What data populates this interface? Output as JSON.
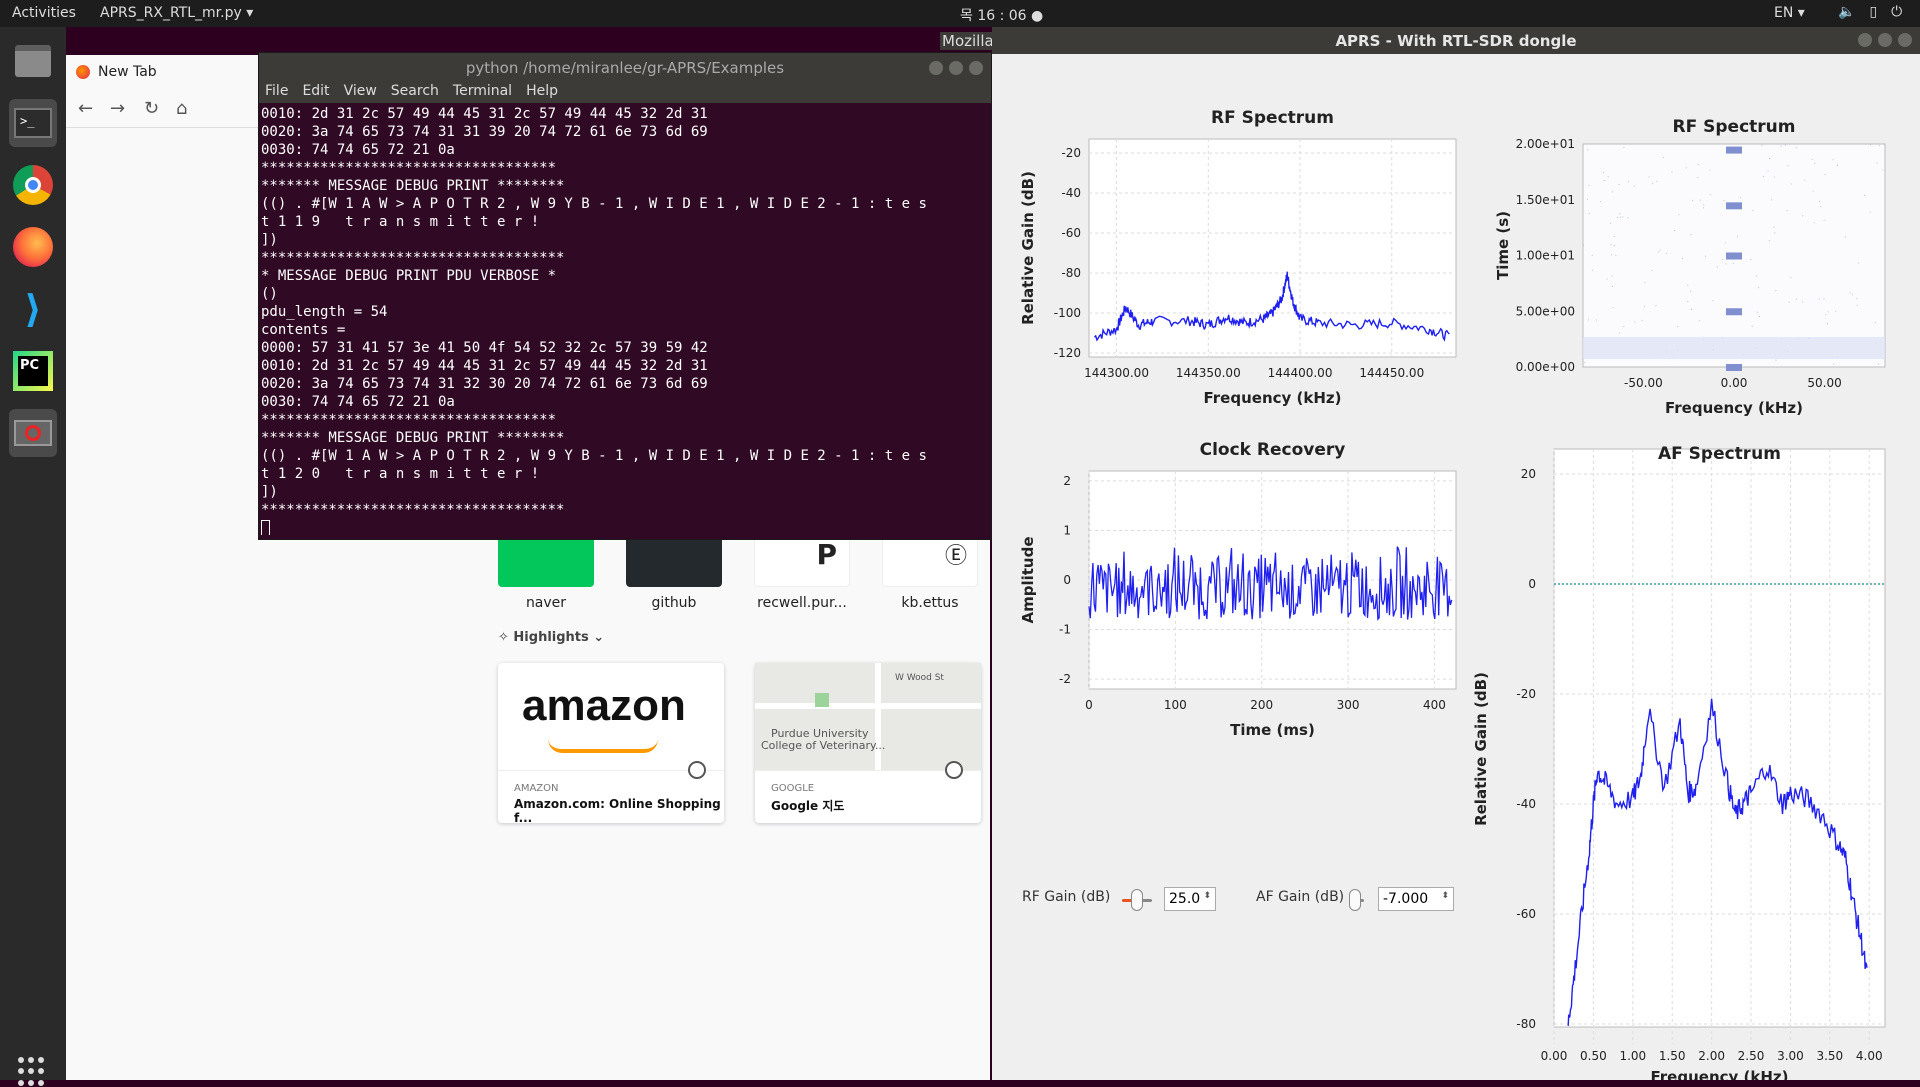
{
  "topbar": {
    "activities": "Activities",
    "app_name": "APRS_RX_RTL_mr.py ▾",
    "clock": "목 16 : 06 ●",
    "lang": "EN ▾"
  },
  "firefox": {
    "tab_title": "New Tab",
    "mozilla_label": "Mozilla",
    "tiles": [
      {
        "label": "naver"
      },
      {
        "label": "github"
      },
      {
        "label": "recwell.pur..."
      },
      {
        "label": "kb.ettus"
      }
    ],
    "highlights_label": "Highlights",
    "cards": [
      {
        "source": "AMAZON",
        "title": "Amazon.com: Online Shopping f...",
        "logo": "amazon"
      },
      {
        "source": "GOOGLE",
        "title": "Google 지도",
        "map_text_1": "Purdue University",
        "map_text_2": "College of Veterinary...",
        "map_street": "W Wood St"
      }
    ]
  },
  "terminal": {
    "title": "python  /home/miranlee/gr-APRS/Examples",
    "menu": [
      "File",
      "Edit",
      "View",
      "Search",
      "Terminal",
      "Help"
    ],
    "lines": [
      "0010: 2d 31 2c 57 49 44 45 31 2c 57 49 44 45 32 2d 31",
      "0020: 3a 74 65 73 74 31 31 39 20 74 72 61 6e 73 6d 69",
      "0030: 74 74 65 72 21 0a",
      "***********************************",
      "******* MESSAGE DEBUG PRINT ********",
      "(() . #[W 1 A W > A P O T R 2 , W 9 Y B - 1 , W I D E 1 , W I D E 2 - 1 : t e s",
      "t 1 1 9   t r a n s m i t t e r !",
      "])",
      "************************************",
      "* MESSAGE DEBUG PRINT PDU VERBOSE *",
      "()",
      "pdu_length = 54",
      "contents =",
      "0000: 57 31 41 57 3e 41 50 4f 54 52 32 2c 57 39 59 42",
      "0010: 2d 31 2c 57 49 44 45 31 2c 57 49 44 45 32 2d 31",
      "0020: 3a 74 65 73 74 31 32 30 20 74 72 61 6e 73 6d 69",
      "0030: 74 74 65 72 21 0a",
      "***********************************",
      "******* MESSAGE DEBUG PRINT ********",
      "(() . #[W 1 A W > A P O T R 2 , W 9 Y B - 1 , W I D E 1 , W I D E 2 - 1 : t e s",
      "t 1 2 0   t r a n s m i t t e r !",
      "])",
      "************************************"
    ]
  },
  "aprs": {
    "window_title": "APRS - With RTL-SDR dongle",
    "rf_gain_label": "RF Gain (dB)",
    "rf_gain_value": "25.0",
    "rf_gain_level": 0.5,
    "af_gain_label": "AF Gain (dB)",
    "af_gain_value": "-7.000",
    "af_gain_level": 0.05
  },
  "chart_data": [
    {
      "type": "line",
      "title": "RF Spectrum",
      "xlabel": "Frequency (kHz)",
      "ylabel": "Relative Gain (dB)",
      "xlim": [
        144285,
        144485
      ],
      "ylim": [
        -123,
        -105
      ],
      "xticks": [
        "144300.00",
        "144350.00",
        "144400.00",
        "144450.00"
      ],
      "yticks": [
        "-20",
        "-40",
        "-60",
        "-80",
        "-100",
        "-120"
      ],
      "yrange": [
        -122,
        -13
      ],
      "series": [
        {
          "color": "#1f1ff0",
          "x": [
            144288,
            144300,
            144305,
            144312,
            144320,
            144340,
            144350,
            144360,
            144370,
            144380,
            144385,
            144390,
            144393,
            144396,
            144400,
            144410,
            144430,
            144450,
            144470,
            144482
          ],
          "y": [
            -112,
            -108,
            -97,
            -106,
            -104,
            -104,
            -106,
            -102,
            -105,
            -103,
            -100,
            -93,
            -81,
            -94,
            -103,
            -105,
            -106,
            -105,
            -108,
            -112
          ]
        }
      ]
    },
    {
      "type": "heatmap",
      "title": "RF Spectrum",
      "xlabel": "Frequency (kHz)",
      "ylabel": "Time (s)",
      "xticks": [
        "-50.00",
        "0.00",
        "50.00"
      ],
      "yticks": [
        "2.00e+01",
        "1.50e+01",
        "1.00e+01",
        "5.00e+00",
        "0.00e+00"
      ],
      "bursts_time": [
        0,
        5,
        10,
        14.5,
        19.5
      ]
    },
    {
      "type": "line",
      "title": "Clock Recovery",
      "xlabel": "Time (ms)",
      "ylabel": "Amplitude",
      "xlim": [
        0,
        425
      ],
      "ylim": [
        -2.2,
        2.2
      ],
      "xticks": [
        "0",
        "100",
        "200",
        "300",
        "400"
      ],
      "yticks": [
        "2",
        "1",
        "0",
        "-1",
        "-2"
      ],
      "series": [
        {
          "color": "#1f1ff0",
          "amplitude_range": [
            -0.8,
            0.8
          ]
        }
      ]
    },
    {
      "type": "line",
      "title": "AF Spectrum",
      "xlabel": "Frequency (kHz)",
      "ylabel": "Relative Gain (dB)",
      "xlim": [
        0,
        4.2
      ],
      "ylim": [
        -80,
        20
      ],
      "xticks": [
        "0.00",
        "0.50",
        "1.00",
        "1.50",
        "2.00",
        "2.50",
        "3.00",
        "3.50",
        "4.00"
      ],
      "yticks": [
        "20",
        "0",
        "-20",
        "-40",
        "-60",
        "-80"
      ],
      "reference_line": 0,
      "series": [
        {
          "color": "#1f1ff0",
          "x": [
            0.18,
            0.25,
            0.35,
            0.45,
            0.5,
            0.55,
            0.65,
            0.8,
            1.0,
            1.1,
            1.2,
            1.4,
            1.6,
            1.7,
            1.8,
            2.0,
            2.2,
            2.3,
            2.4,
            2.5,
            2.7,
            2.9,
            3.0,
            3.2,
            3.4,
            3.6,
            3.7,
            3.8,
            3.9,
            3.98
          ],
          "y": [
            -80,
            -72,
            -60,
            -48,
            -40,
            -34,
            -36,
            -40,
            -39,
            -35,
            -23,
            -37,
            -25,
            -38,
            -37,
            -22,
            -36,
            -42,
            -40,
            -38,
            -33,
            -40,
            -38,
            -39,
            -42,
            -47,
            -50,
            -58,
            -65,
            -72
          ]
        }
      ]
    }
  ]
}
